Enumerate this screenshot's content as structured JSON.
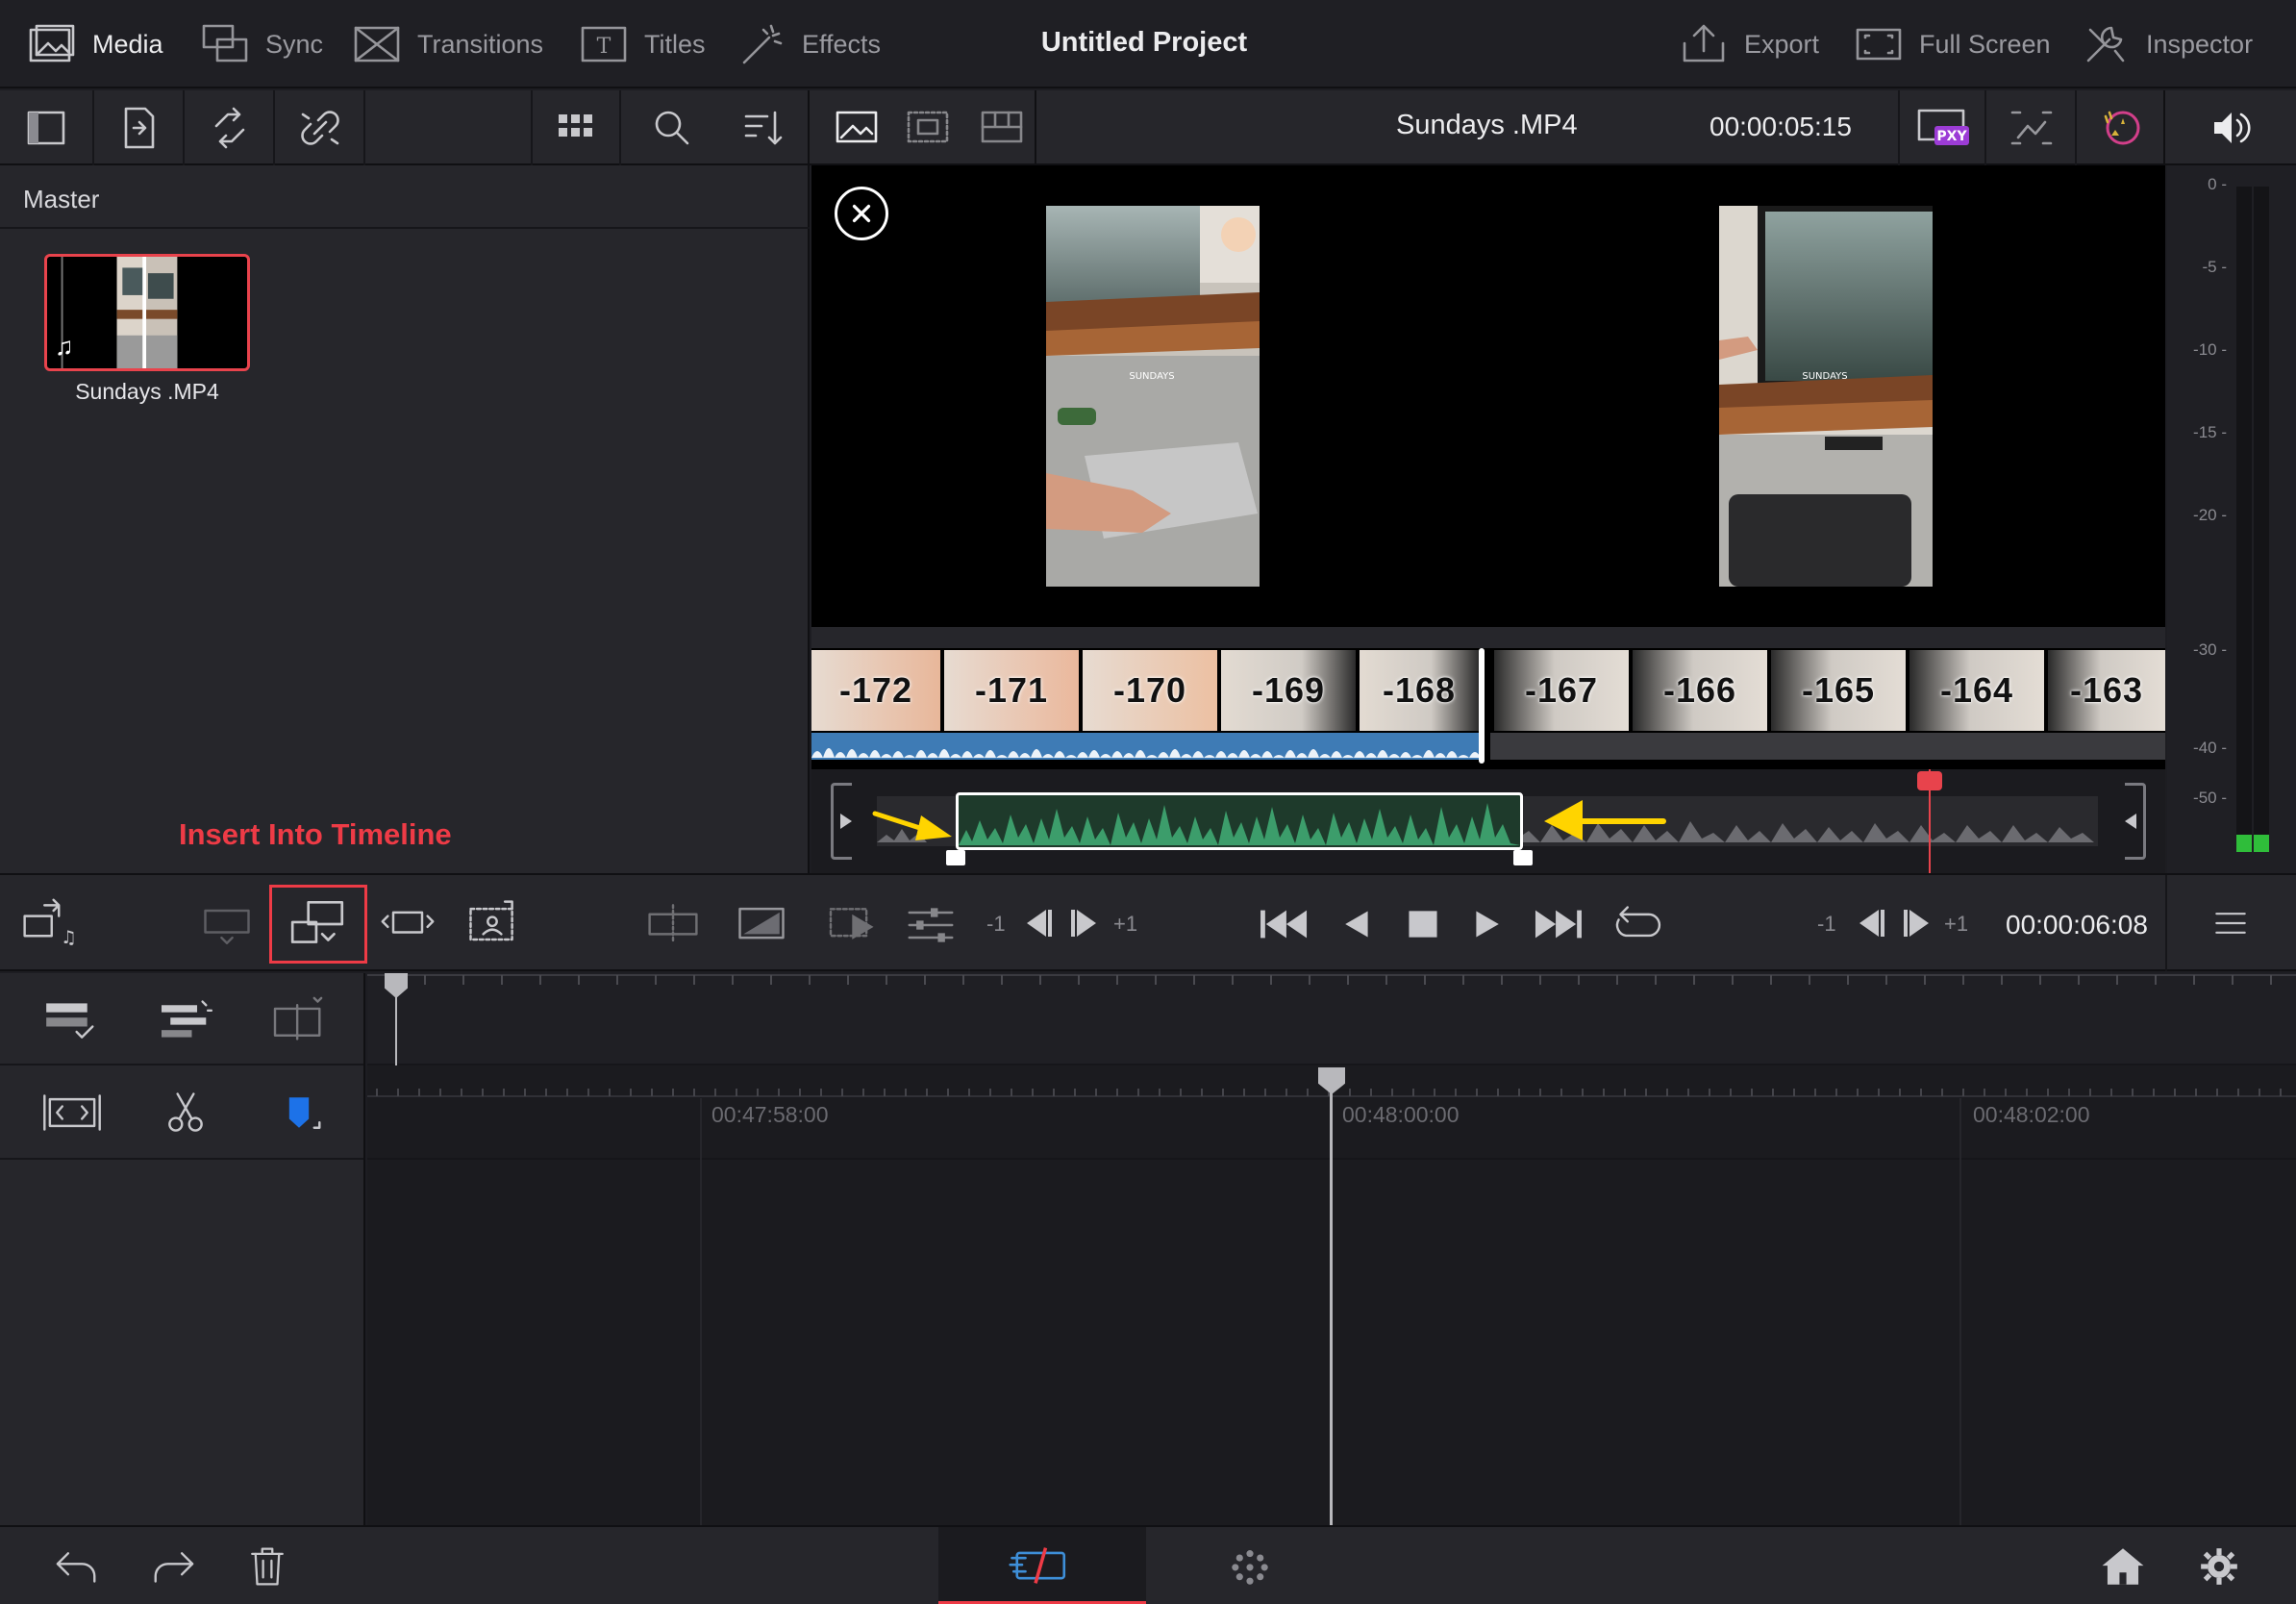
{
  "topbar": {
    "tabs": [
      {
        "label": "Media",
        "icon": "media-icon",
        "active": true
      },
      {
        "label": "Sync",
        "icon": "sync-icon",
        "active": false
      },
      {
        "label": "Transitions",
        "icon": "transitions-icon",
        "active": false
      },
      {
        "label": "Titles",
        "icon": "titles-icon",
        "active": false
      },
      {
        "label": "Effects",
        "icon": "effects-icon",
        "active": false
      }
    ],
    "project_title": "Untitled Project",
    "right_tabs": [
      {
        "label": "Export",
        "icon": "export-icon"
      },
      {
        "label": "Full Screen",
        "icon": "full-screen-icon"
      },
      {
        "label": "Inspector",
        "icon": "inspector-icon"
      }
    ]
  },
  "media_pool": {
    "title": "Master",
    "clip_name": "Sundays .MP4",
    "annotation": "Insert Into Timeline"
  },
  "viewer": {
    "clip_name": "Sundays .MP4",
    "timecode": "00:00:05:15",
    "proxy_badge": "PXY",
    "frames": [
      "-172",
      "-171",
      "-170",
      "-169",
      "-168",
      "-167",
      "-166",
      "-165",
      "-164",
      "-163"
    ],
    "preview_caption": "SUNDAYS"
  },
  "meter": {
    "ticks": [
      "0 -",
      "-5 -",
      "-10 -",
      "-15 -",
      "-20 -",
      "-30 -",
      "-40 -",
      "-50 -"
    ]
  },
  "transport": {
    "minus_one": "-1",
    "plus_one": "+1",
    "timecode": "00:00:06:08"
  },
  "timeline": {
    "ruler": [
      "00:47:58:00",
      "00:48:00:00",
      "00:48:02:00"
    ]
  },
  "colors": {
    "accent_red": "#ee3b46",
    "waveform_green": "#3c9d6b",
    "audio_blue": "#3e7bb5",
    "flag_blue": "#1d72e8",
    "arrow_yellow": "#ffd400"
  }
}
